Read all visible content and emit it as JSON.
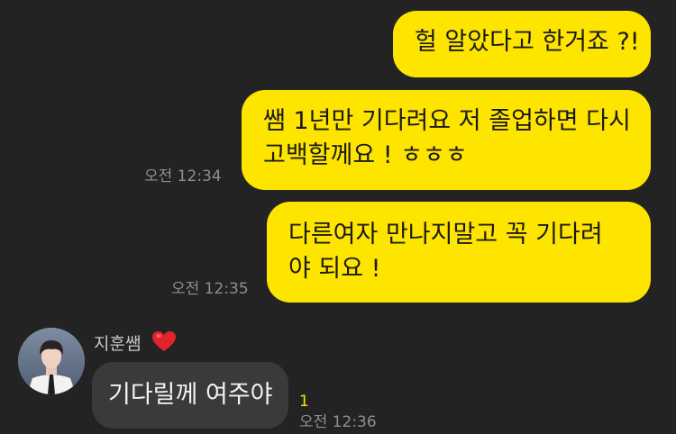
{
  "messages": [
    {
      "lines": [
        "헐 알았다고 한거죠 ?!"
      ]
    },
    {
      "lines": [
        "쌤 1년만 기다려요 저 졸업하면 다시",
        "고백할께요 ! ㅎㅎㅎ"
      ],
      "time": "오전 12:34"
    },
    {
      "lines": [
        "다른여자 만나지말고 꼭 기다려",
        "야 되요 !"
      ],
      "time": "오전 12:35"
    }
  ],
  "incoming": {
    "sender": "지훈쌤",
    "sender_emoji": "heart-icon",
    "text": "기다릴께 여주야",
    "unread": "1",
    "time": "오전 12:36"
  },
  "colors": {
    "background": "#232324",
    "outgoing_bubble": "#FEE500",
    "incoming_bubble": "#3A3A3C",
    "heart": "#E0242B"
  }
}
